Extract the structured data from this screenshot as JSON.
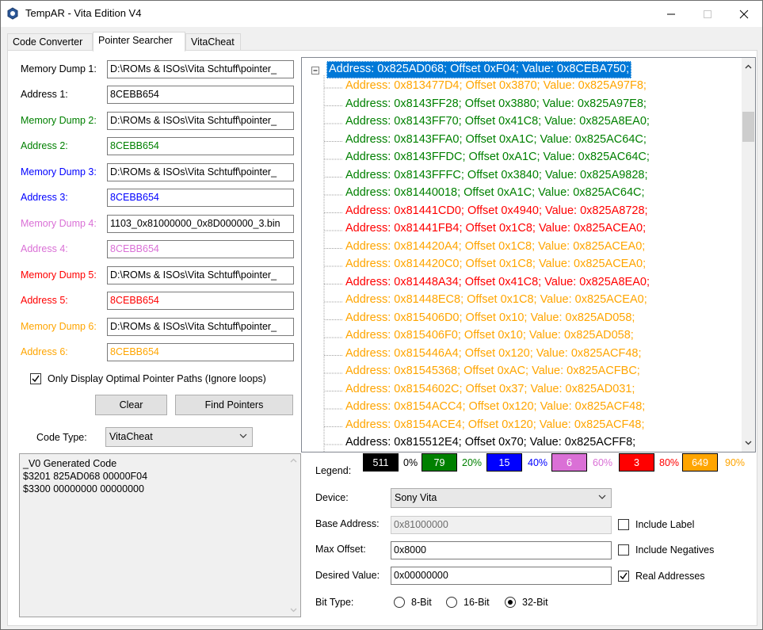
{
  "window": {
    "title": "TempAR - Vita Edition  V4"
  },
  "tabs": [
    {
      "label": "Code Converter"
    },
    {
      "label": "Pointer Searcher"
    },
    {
      "label": "VitaCheat"
    }
  ],
  "dumps": [
    {
      "dump_label": "Memory Dump 1:",
      "dump_value": "D:\\ROMs & ISOs\\Vita Schtuff\\pointer_",
      "addr_label": "Address 1:",
      "addr_value": "8CEBB654",
      "color": "#000000"
    },
    {
      "dump_label": "Memory Dump 2:",
      "dump_value": "D:\\ROMs & ISOs\\Vita Schtuff\\pointer_",
      "addr_label": "Address 2:",
      "addr_value": "8CEBB654",
      "color": "#008000"
    },
    {
      "dump_label": "Memory Dump 3:",
      "dump_value": "D:\\ROMs & ISOs\\Vita Schtuff\\pointer_",
      "addr_label": "Address 3:",
      "addr_value": "8CEBB654",
      "color": "#0000ff"
    },
    {
      "dump_label": "Memory Dump 4:",
      "dump_value": "1103_0x81000000_0x8D000000_3.bin",
      "addr_label": "Address 4:",
      "addr_value": "8CEBB654",
      "color": "#da70d6"
    },
    {
      "dump_label": "Memory Dump 5:",
      "dump_value": "D:\\ROMs & ISOs\\Vita Schtuff\\pointer_",
      "addr_label": "Address 5:",
      "addr_value": "8CEBB654",
      "color": "#ff0000"
    },
    {
      "dump_label": "Memory Dump 6:",
      "dump_value": "D:\\ROMs & ISOs\\Vita Schtuff\\pointer_",
      "addr_label": "Address 6:",
      "addr_value": "8CEBB654",
      "color": "#ffa500"
    }
  ],
  "options": {
    "optimal_paths_label": "Only Display Optimal Pointer Paths (Ignore loops)",
    "optimal_paths_checked": true
  },
  "buttons": {
    "clear": "Clear",
    "find_pointers": "Find Pointers"
  },
  "code_type": {
    "label": "Code Type:",
    "value": "VitaCheat"
  },
  "generated_code": {
    "lines": [
      "_V0 Generated Code",
      "$3201 825AD068 00000F04",
      "$3300 00000000 00000000"
    ]
  },
  "tree": {
    "root": "Address: 0x825AD068; Offset 0xF04; Value: 0x8CEBA750;",
    "rows": [
      {
        "text": "Address: 0x813477D4; Offset 0x3870; Value: 0x825A97F8;",
        "color": "#ffa500"
      },
      {
        "text": "Address: 0x8143FF28; Offset 0x3880; Value: 0x825A97E8;",
        "color": "#008000"
      },
      {
        "text": "Address: 0x8143FF70; Offset 0x41C8; Value: 0x825A8EA0;",
        "color": "#008000"
      },
      {
        "text": "Address: 0x8143FFA0; Offset 0xA1C; Value: 0x825AC64C;",
        "color": "#008000"
      },
      {
        "text": "Address: 0x8143FFDC; Offset 0xA1C; Value: 0x825AC64C;",
        "color": "#008000"
      },
      {
        "text": "Address: 0x8143FFFC; Offset 0x3840; Value: 0x825A9828;",
        "color": "#008000"
      },
      {
        "text": "Address: 0x81440018; Offset 0xA1C; Value: 0x825AC64C;",
        "color": "#008000"
      },
      {
        "text": "Address: 0x81441CD0; Offset 0x4940; Value: 0x825A8728;",
        "color": "#ff0000"
      },
      {
        "text": "Address: 0x81441FB4; Offset 0x1C8; Value: 0x825ACEA0;",
        "color": "#ff0000"
      },
      {
        "text": "Address: 0x814420A4; Offset 0x1C8; Value: 0x825ACEA0;",
        "color": "#ffa500"
      },
      {
        "text": "Address: 0x814420C0; Offset 0x1C8; Value: 0x825ACEA0;",
        "color": "#ffa500"
      },
      {
        "text": "Address: 0x81448A34; Offset 0x41C8; Value: 0x825A8EA0;",
        "color": "#ff0000"
      },
      {
        "text": "Address: 0x81448EC8; Offset 0x1C8; Value: 0x825ACEA0;",
        "color": "#ffa500"
      },
      {
        "text": "Address: 0x815406D0; Offset 0x10; Value: 0x825AD058;",
        "color": "#ffa500"
      },
      {
        "text": "Address: 0x815406F0; Offset 0x10; Value: 0x825AD058;",
        "color": "#ffa500"
      },
      {
        "text": "Address: 0x815446A4; Offset 0x120; Value: 0x825ACF48;",
        "color": "#ffa500"
      },
      {
        "text": "Address: 0x81545368; Offset 0xAC; Value: 0x825ACFBC;",
        "color": "#ffa500"
      },
      {
        "text": "Address: 0x8154602C; Offset 0x37; Value: 0x825AD031;",
        "color": "#ffa500"
      },
      {
        "text": "Address: 0x8154ACC4; Offset 0x120; Value: 0x825ACF48;",
        "color": "#ffa500"
      },
      {
        "text": "Address: 0x8154ACE4; Offset 0x120; Value: 0x825ACF48;",
        "color": "#ffa500"
      },
      {
        "text": "Address: 0x815512E4; Offset 0x70; Value: 0x825ACFF8;",
        "color": "#000000"
      }
    ]
  },
  "legend": {
    "label": "Legend:",
    "items": [
      {
        "count": "511",
        "pct": "0%",
        "bg": "#000000",
        "fg": "#ffffff",
        "pct_color": "#000000"
      },
      {
        "count": "79",
        "pct": "20%",
        "bg": "#008000",
        "fg": "#ffffff",
        "pct_color": "#008000"
      },
      {
        "count": "15",
        "pct": "40%",
        "bg": "#0000ff",
        "fg": "#ffffff",
        "pct_color": "#0000ff"
      },
      {
        "count": "6",
        "pct": "60%",
        "bg": "#da70d6",
        "fg": "#ffffff",
        "pct_color": "#da70d6"
      },
      {
        "count": "3",
        "pct": "80%",
        "bg": "#ff0000",
        "fg": "#ffffff",
        "pct_color": "#ff0000"
      },
      {
        "count": "649",
        "pct": "90%",
        "bg": "#ffa500",
        "fg": "#ffffff",
        "pct_color": "#ffa500"
      }
    ]
  },
  "settings": {
    "device_label": "Device:",
    "device_value": "Sony Vita",
    "base_label": "Base Address:",
    "base_value": "0x81000000",
    "max_offset_label": "Max Offset:",
    "max_offset_value": "0x8000",
    "desired_label": "Desired Value:",
    "desired_value": "0x00000000",
    "include_label": "Include Label",
    "include_label_checked": false,
    "include_negatives": "Include Negatives",
    "include_negatives_checked": false,
    "real_addresses": "Real Addresses",
    "real_addresses_checked": true,
    "bit_type_label": "Bit Type:",
    "bit_options": [
      {
        "label": "8-Bit",
        "selected": false
      },
      {
        "label": "16-Bit",
        "selected": false
      },
      {
        "label": "32-Bit",
        "selected": true
      }
    ]
  }
}
